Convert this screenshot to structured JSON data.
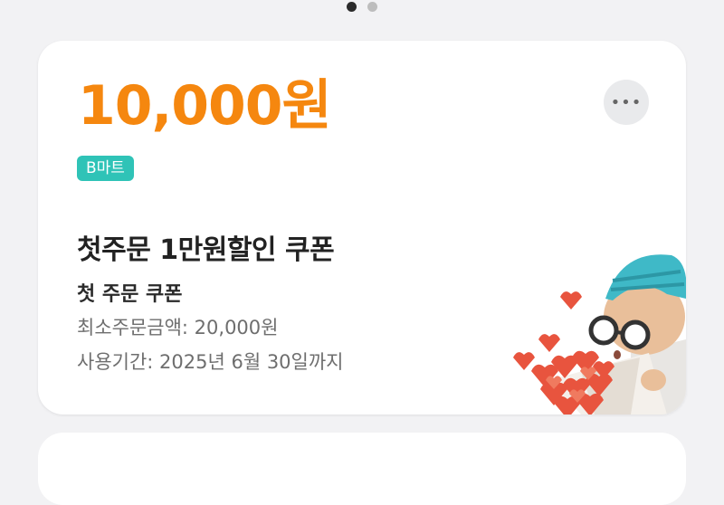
{
  "pagination": {
    "total": 2,
    "active_index": 0
  },
  "coupon": {
    "amount": "10,000원",
    "badge": "B마트",
    "title": "첫주문 1만원할인 쿠폰",
    "subtitle": "첫 주문 쿠폰",
    "min_order": "최소주문금액: 20,000원",
    "expiry": "사용기간: 2025년 6월 30일까지",
    "more_icon": "more-horizontal-icon",
    "illustration": "character-with-hearts-bouquet"
  },
  "colors": {
    "amount": "#f5870f",
    "badge_bg": "#2fc3b7",
    "background": "#f2f2f4"
  }
}
